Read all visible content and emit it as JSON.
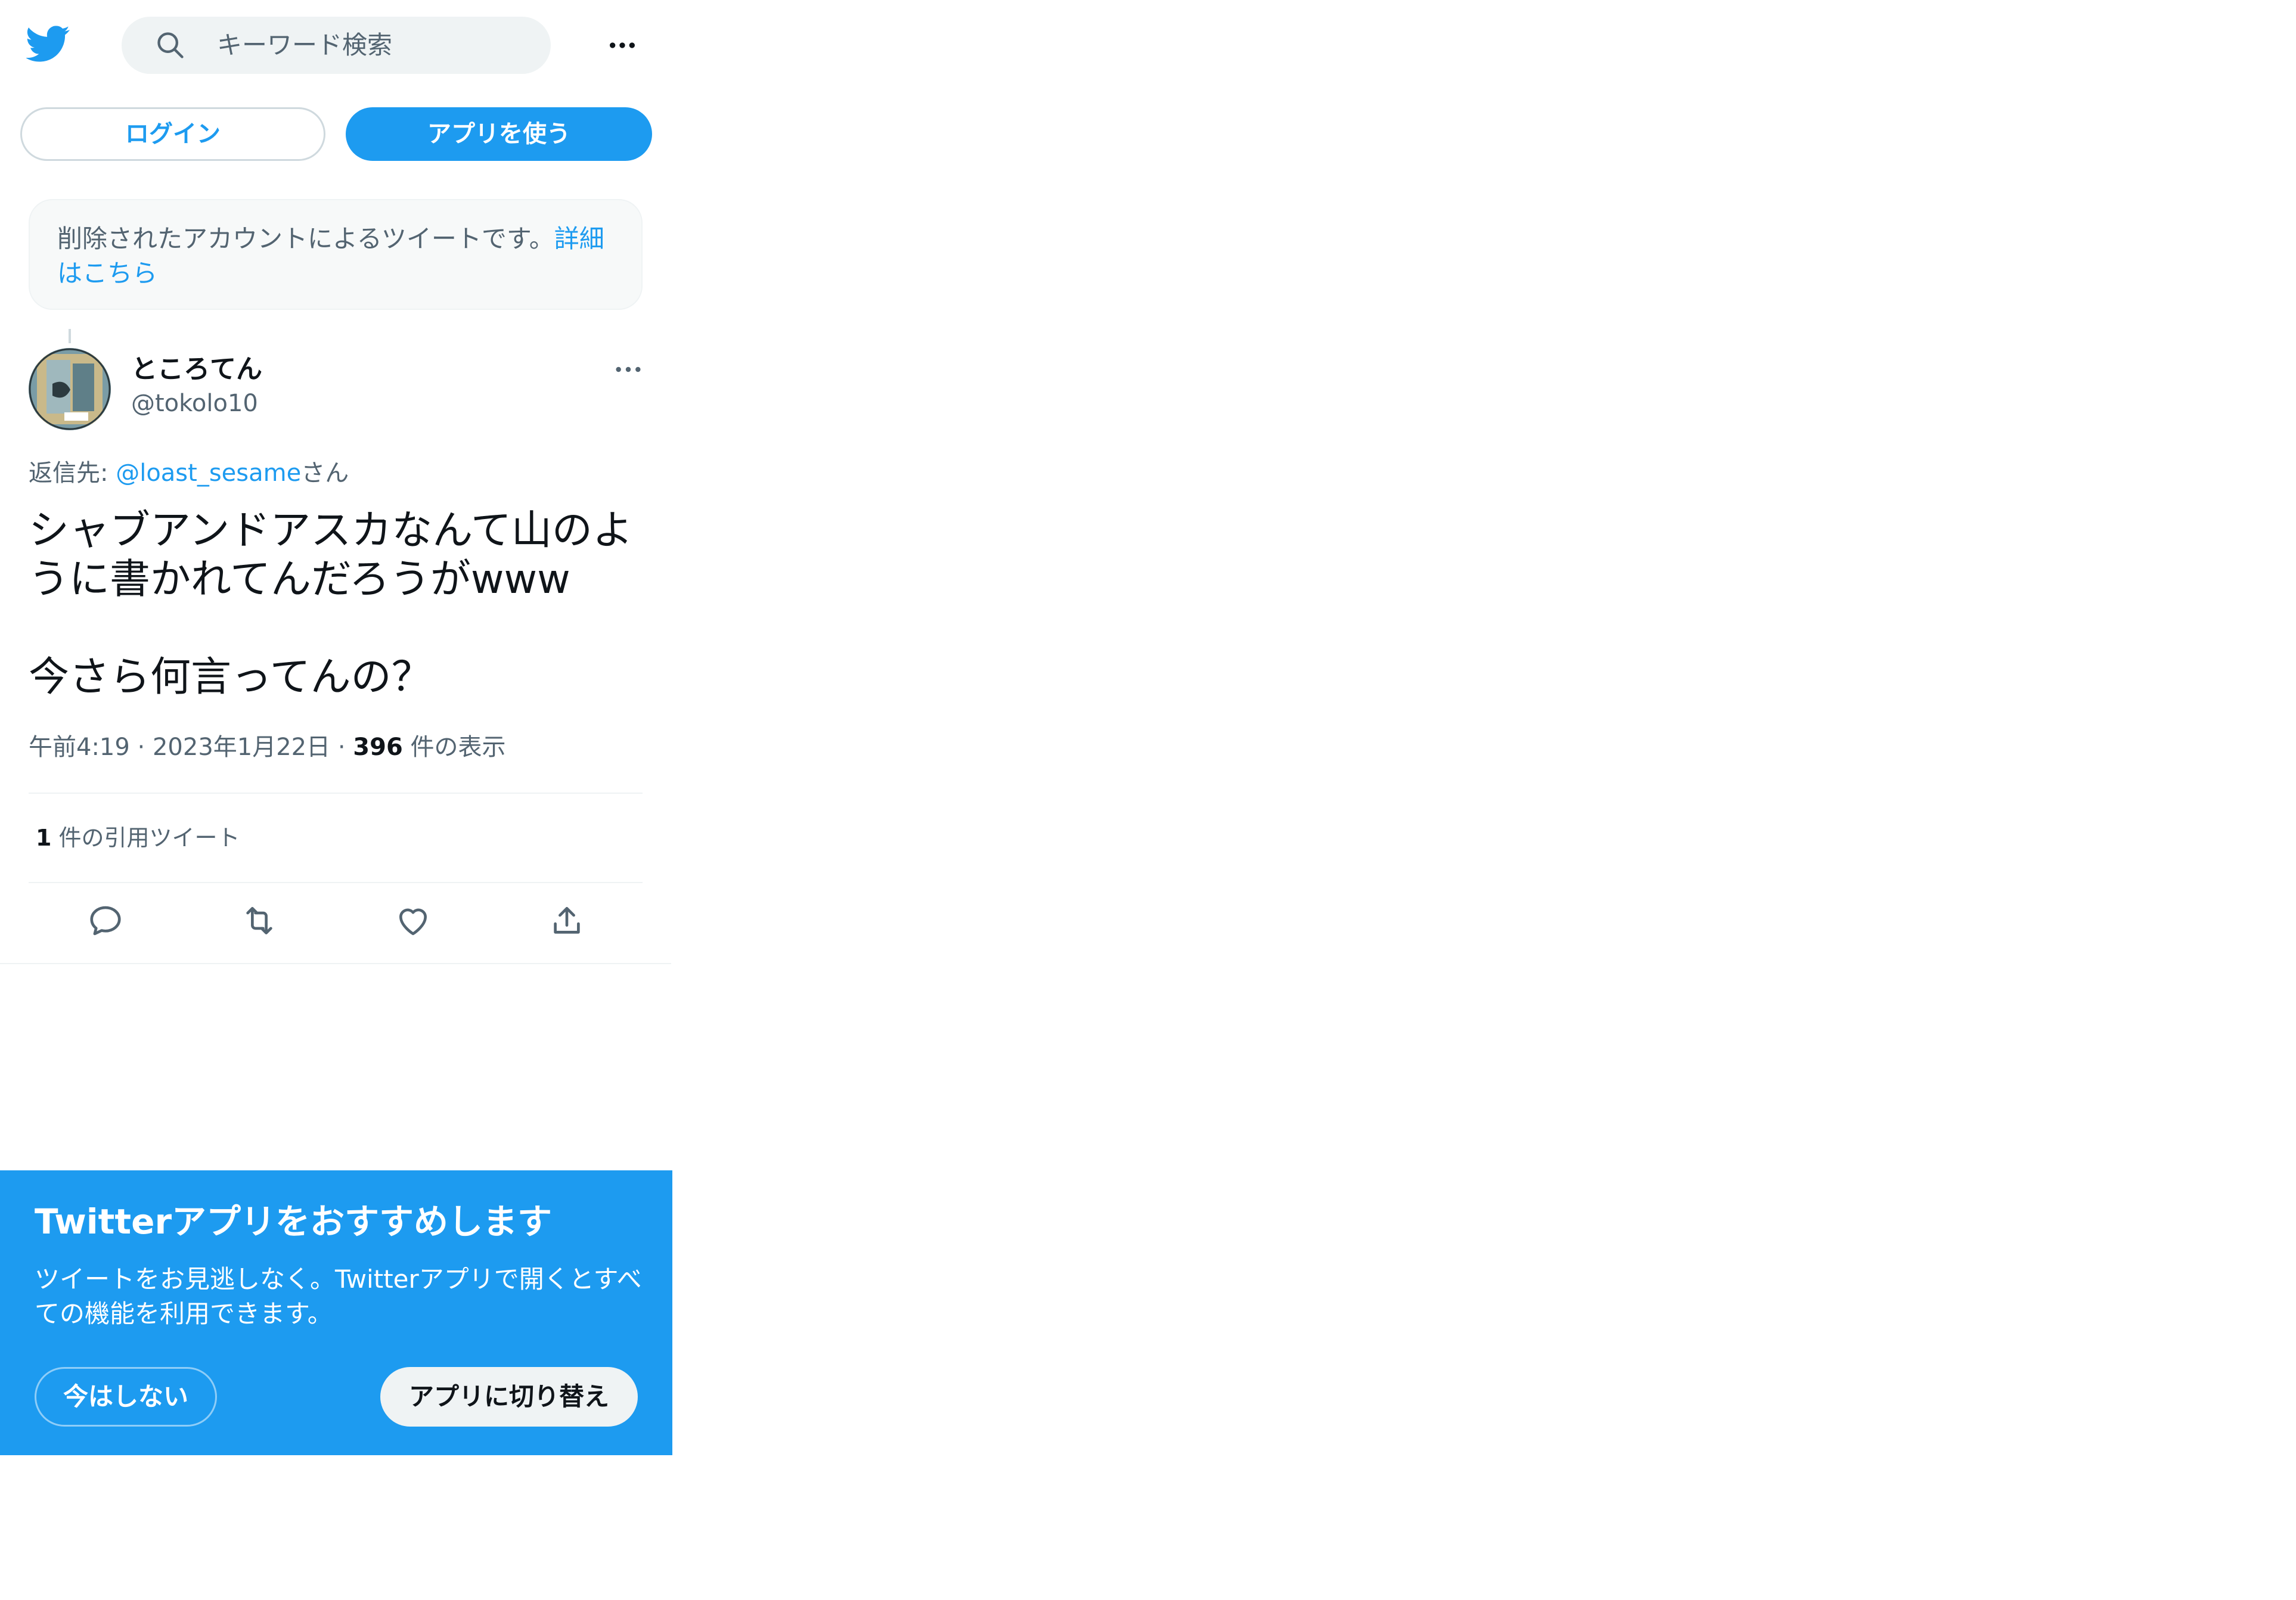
{
  "colors": {
    "accent": "#1d9bf0",
    "muted": "#536471",
    "text": "#0f1419"
  },
  "header": {
    "logo_icon": "twitter-bird-icon",
    "search_placeholder": "キーワード検索",
    "more_icon": "more-horizontal-icon"
  },
  "auth": {
    "login_label": "ログイン",
    "use_app_label": "アプリを使う"
  },
  "deleted_notice": {
    "text": "削除されたアカウントによるツイートです。",
    "link": "詳細はこちら"
  },
  "tweet": {
    "display_name": "ところてん",
    "handle": "@tokolo10",
    "reply_prefix": "返信先: ",
    "reply_mention": "@loast_sesame",
    "reply_suffix": "さん",
    "body": "シャブアンドアスカなんて山のように書かれてんだろうがwww\n\n今さら何言ってんの？",
    "time": "午前4:19",
    "date": "2023年1月22日",
    "views_count": "396",
    "views_label": "件の表示",
    "quote_count": "1",
    "quote_label": "件の引用ツイート"
  },
  "actions": [
    "reply-icon",
    "retweet-icon",
    "like-icon",
    "share-icon"
  ],
  "promo": {
    "title": "Twitterアプリをおすすめします",
    "desc": "ツイートをお見逃しなく。Twitterアプリで開くとすべての機能を利用できます。",
    "not_now": "今はしない",
    "switch": "アプリに切り替え"
  }
}
